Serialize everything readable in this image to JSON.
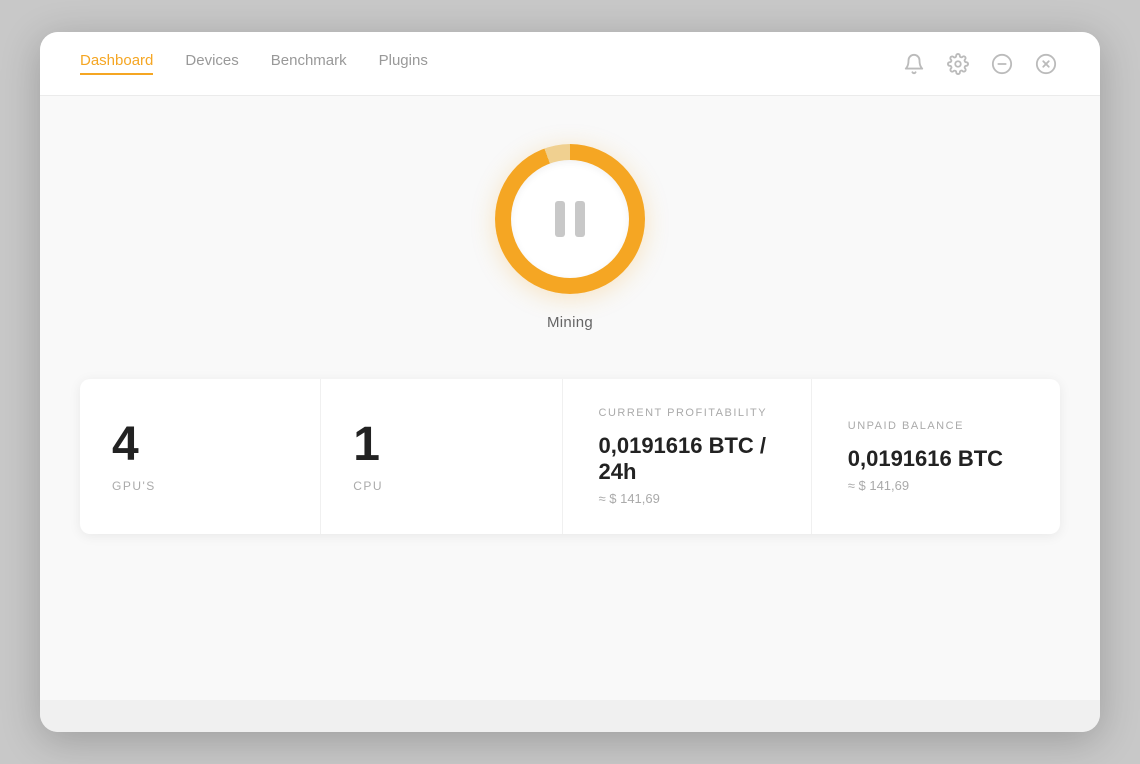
{
  "nav": {
    "items": [
      {
        "label": "Dashboard",
        "active": true
      },
      {
        "label": "Devices",
        "active": false
      },
      {
        "label": "Benchmark",
        "active": false
      },
      {
        "label": "Plugins",
        "active": false
      }
    ]
  },
  "header_icons": [
    {
      "name": "bell-icon",
      "symbol": "🔔"
    },
    {
      "name": "settings-icon",
      "symbol": "⚙"
    },
    {
      "name": "minimize-icon",
      "symbol": "⊖"
    },
    {
      "name": "close-icon",
      "symbol": "⊗"
    }
  ],
  "mining": {
    "label": "Mining",
    "state": "paused"
  },
  "stats": [
    {
      "type": "simple",
      "value": "4",
      "label": "GPU'S"
    },
    {
      "type": "simple",
      "value": "1",
      "label": "CPU"
    },
    {
      "type": "detailed",
      "title": "CURRENT PROFITABILITY",
      "main_value": "0,0191616 BTC / 24h",
      "sub_value": "≈ $ 141,69"
    },
    {
      "type": "detailed",
      "title": "UNPAID BALANCE",
      "main_value": "0,0191616 BTC",
      "sub_value": "≈ $ 141,69"
    }
  ]
}
